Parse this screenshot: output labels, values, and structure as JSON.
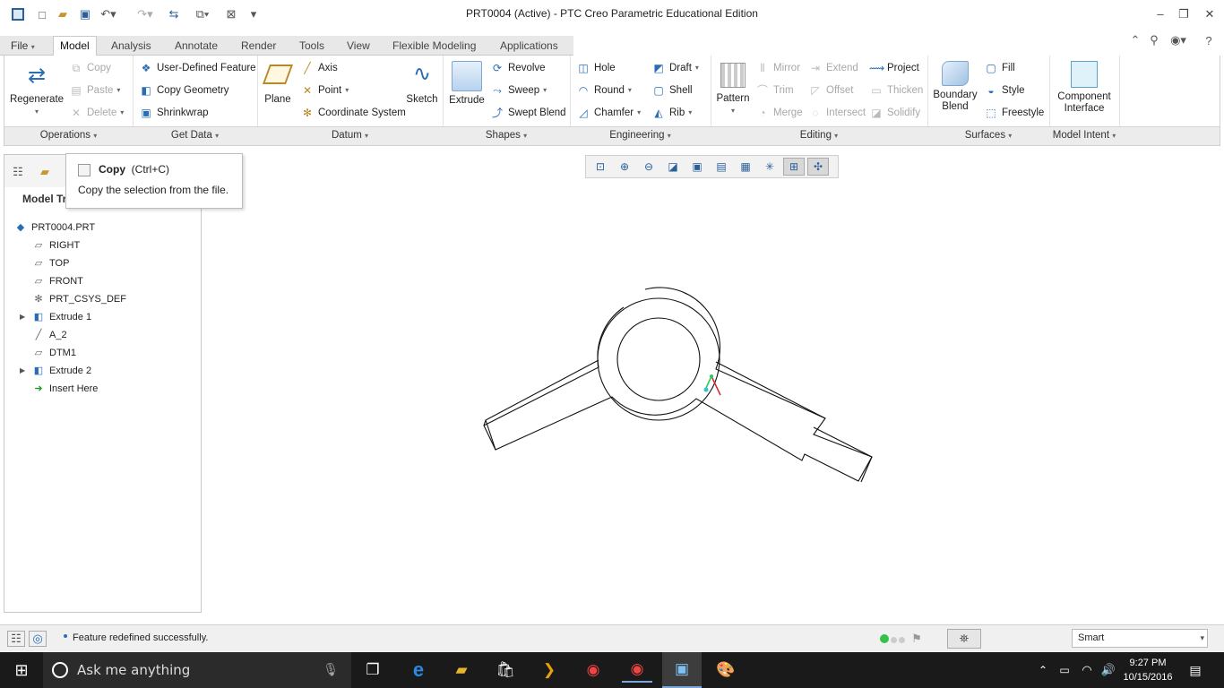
{
  "window": {
    "title": "PRT0004 (Active) - PTC Creo Parametric Educational Edition"
  },
  "tabs": [
    {
      "label": "File"
    },
    {
      "label": "Model"
    },
    {
      "label": "Analysis"
    },
    {
      "label": "Annotate"
    },
    {
      "label": "Render"
    },
    {
      "label": "Tools"
    },
    {
      "label": "View"
    },
    {
      "label": "Flexible Modeling"
    },
    {
      "label": "Applications"
    }
  ],
  "ribbon": {
    "operations": {
      "regenerate": "Regenerate",
      "copy": "Copy",
      "paste": "Paste",
      "delete": "Delete",
      "group": "Operations"
    },
    "get_data": {
      "udf": "User-Defined Feature",
      "copy_geometry": "Copy Geometry",
      "shrinkwrap": "Shrinkwrap",
      "group": "Get Data"
    },
    "datum": {
      "plane": "Plane",
      "axis": "Axis",
      "point": "Point",
      "csys": "Coordinate System",
      "sketch": "Sketch",
      "group": "Datum"
    },
    "shapes": {
      "extrude": "Extrude",
      "revolve": "Revolve",
      "sweep": "Sweep",
      "swept_blend": "Swept Blend",
      "group": "Shapes"
    },
    "engineering": {
      "hole": "Hole",
      "round": "Round",
      "chamfer": "Chamfer",
      "draft": "Draft",
      "shell": "Shell",
      "rib": "Rib",
      "group": "Engineering"
    },
    "editing": {
      "pattern": "Pattern",
      "mirror": "Mirror",
      "trim": "Trim",
      "merge": "Merge",
      "extend": "Extend",
      "offset": "Offset",
      "intersect": "Intersect",
      "project": "Project",
      "thicken": "Thicken",
      "solidify": "Solidify",
      "group": "Editing"
    },
    "surfaces": {
      "boundary_blend_1": "Boundary",
      "boundary_blend_2": "Blend",
      "fill": "Fill",
      "style": "Style",
      "freestyle": "Freestyle",
      "group": "Surfaces"
    },
    "model_intent": {
      "component_1": "Component",
      "component_2": "Interface",
      "group": "Model Intent"
    }
  },
  "tooltip": {
    "title": "Copy",
    "shortcut": "(Ctrl+C)",
    "description": "Copy the selection from the file."
  },
  "model_tree": {
    "title": "Model Tr",
    "items": [
      {
        "label": "PRT0004.PRT",
        "icon": "part-icon"
      },
      {
        "label": "RIGHT",
        "icon": "datum-plane-icon"
      },
      {
        "label": "TOP",
        "icon": "datum-plane-icon"
      },
      {
        "label": "FRONT",
        "icon": "datum-plane-icon"
      },
      {
        "label": "PRT_CSYS_DEF",
        "icon": "csys-icon"
      },
      {
        "label": "Extrude 1",
        "icon": "extrude-icon"
      },
      {
        "label": "A_2",
        "icon": "axis-icon"
      },
      {
        "label": "DTM1",
        "icon": "datum-plane-icon"
      },
      {
        "label": "Extrude 2",
        "icon": "extrude-icon"
      },
      {
        "label": "Insert Here",
        "icon": "insert-arrow-icon"
      }
    ]
  },
  "status": {
    "message": "Feature redefined successfully.",
    "filter": "Smart"
  },
  "taskbar": {
    "search_placeholder": "Ask me anything",
    "time": "9:27 PM",
    "date": "10/15/2016"
  }
}
